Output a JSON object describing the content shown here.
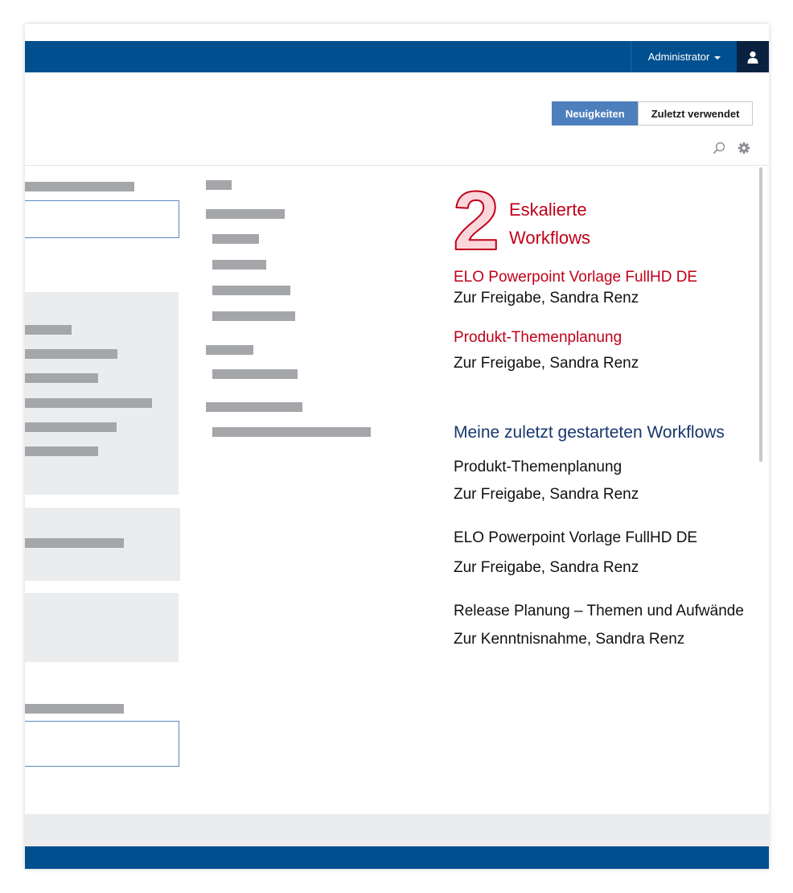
{
  "header": {
    "user_menu_label": "Administrator",
    "user_icon": "user-icon",
    "accent_color": "#00508f"
  },
  "tabs": {
    "news_label": "Neuigkeiten",
    "recent_label": "Zuletzt verwendet",
    "active": "Neuigkeiten"
  },
  "toolbar": {
    "search_icon": "search-icon",
    "settings_icon": "gear-icon"
  },
  "escalated": {
    "count": "2",
    "label_line1": "Eskalierte",
    "label_line2": "Workflows",
    "items": [
      {
        "title": "ELO Powerpoint Vorlage FullHD DE",
        "detail": "Zur Freigabe, Sandra Renz"
      },
      {
        "title": "Produkt-Themenplanung",
        "detail": "Zur Freigabe, Sandra Renz"
      }
    ]
  },
  "recent_workflows": {
    "heading": "Meine zuletzt gestarteten Workflows",
    "items": [
      {
        "title": "Produkt-Themenplanung",
        "detail": "Zur Freigabe, Sandra Renz"
      },
      {
        "title": "ELO Powerpoint Vorlage FullHD DE",
        "detail": "Zur Freigabe, Sandra Renz"
      },
      {
        "title": "Release Planung – Themen und Aufwände",
        "detail": "Zur Kenntnisnahme, Sandra Renz"
      }
    ]
  }
}
